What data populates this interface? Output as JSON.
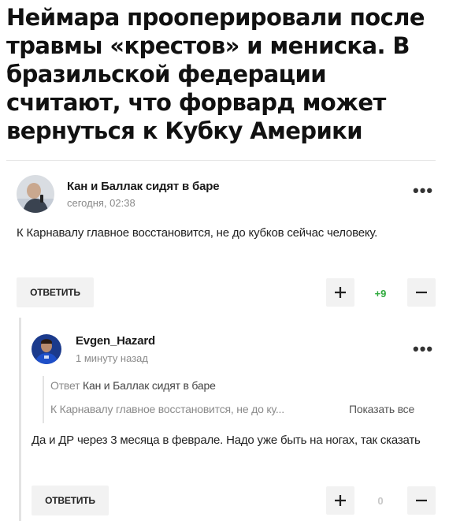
{
  "article": {
    "headline": "Неймара прооперировали после травмы «крестов» и мениска. В бразильской федерации считают, что форвард может вернуться к Кубку Америки"
  },
  "comments": [
    {
      "author": "Кан и Баллак сидят в баре",
      "time": "сегодня, 02:38",
      "text": "К Карнавалу главное восстановится, не до кубков сейчас человеку.",
      "reply_label": "ОТВЕТИТЬ",
      "score": "+9",
      "score_color": "#2eaa3c"
    },
    {
      "author": "Evgen_Hazard",
      "time": "1 минуту назад",
      "quote_prefix": "Ответ",
      "quote_author": "Кан и Баллак сидят в баре",
      "quote_text": "К Карнавалу главное восстановится, не до ку...",
      "show_all": "Показать все",
      "text": "Да и ДР через 3 месяца в феврале. Надо уже быть на ногах, так сказать",
      "reply_label": "ОТВЕТИТЬ",
      "score": "0",
      "score_color": "#c8c8c8"
    }
  ],
  "icons": {
    "more": "more-dots-icon",
    "upvote": "plus-icon",
    "downvote": "minus-icon"
  }
}
